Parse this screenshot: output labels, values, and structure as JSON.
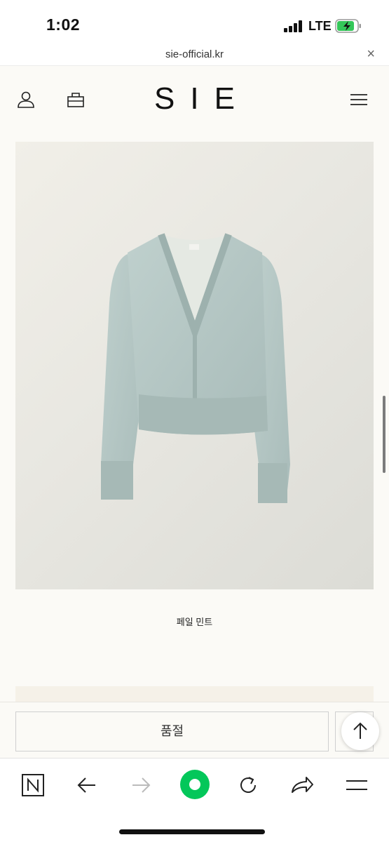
{
  "status_bar": {
    "time": "1:02",
    "network": "LTE",
    "battery_level": 0.75,
    "battery_charging": true
  },
  "url_bar": {
    "url": "sie-official.kr",
    "close_label": "×"
  },
  "header": {
    "logo": "SIE",
    "icons": [
      "user-icon",
      "bag-icon",
      "menu-icon"
    ]
  },
  "product": {
    "name": "페일 민트",
    "color_swatch": "#b7c9c6"
  },
  "actions": {
    "soldout_label": "품절"
  },
  "browser_nav": {
    "icons": [
      "naver-n-icon",
      "back-arrow-icon",
      "forward-arrow-icon",
      "home-dot-icon",
      "reload-icon",
      "share-icon",
      "hamburger-icon"
    ],
    "accent": "#03c75a"
  }
}
